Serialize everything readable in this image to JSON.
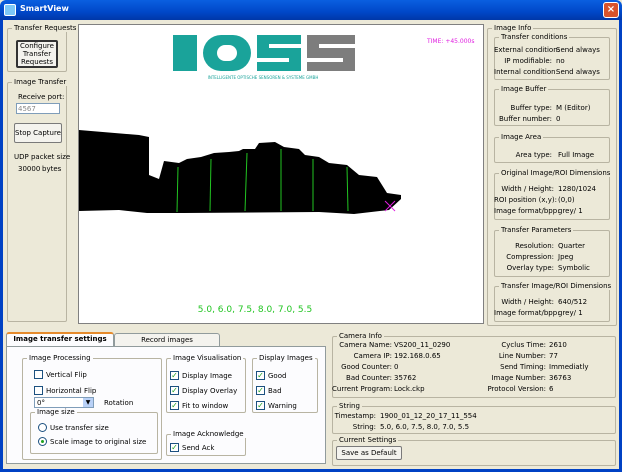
{
  "window": {
    "title": "SmartView",
    "close": "×"
  },
  "transfer_requests": {
    "label": "Transfer Requests",
    "button": "Configure Transfer Requests"
  },
  "image_transfer": {
    "label": "Image Transfer",
    "receive_port_label": "Receive port:",
    "receive_port_value": "4567",
    "stop_button": "Stop Capture",
    "udp_label": "UDP packet size",
    "udp_value": "30000",
    "udp_unit": "bytes"
  },
  "image": {
    "logo": "IOSS",
    "logo_sub": "INTELLIGENTE OPTISCHE SENSOREN & SYSTEME GMBH",
    "time": "TIME: +45.000s",
    "readings": "5.0,  6.0,  7.5,  8.0,  7.0,  5.5"
  },
  "image_info": {
    "label": "Image Info",
    "transfer_conditions": {
      "label": "Transfer conditions",
      "rows": [
        {
          "k": "External condition:",
          "v": "Send always"
        },
        {
          "k": "IP modifiable:",
          "v": "no"
        },
        {
          "k": "Internal condition:",
          "v": "Send always"
        }
      ]
    },
    "image_buffer": {
      "label": "Image Buffer",
      "rows": [
        {
          "k": "Buffer type:",
          "v": "M (Editor)"
        },
        {
          "k": "Buffer number:",
          "v": "0"
        }
      ]
    },
    "image_area": {
      "label": "Image Area",
      "rows": [
        {
          "k": "Area type:",
          "v": "Full Image"
        }
      ]
    },
    "original_dims": {
      "label": "Original Image/ROI Dimensions",
      "rows": [
        {
          "k": "Width / Height:",
          "v": "1280/1024"
        },
        {
          "k": "ROI position (x,y):",
          "v": "(0,0)"
        },
        {
          "k": "Image format/bpp:",
          "v": "grey/ 1"
        }
      ]
    },
    "transfer_params": {
      "label": "Transfer Parameters",
      "rows": [
        {
          "k": "Resolution:",
          "v": "Quarter"
        },
        {
          "k": "Compression:",
          "v": "Jpeg"
        },
        {
          "k": "Overlay type:",
          "v": "Symbolic"
        }
      ]
    },
    "transfer_dims": {
      "label": "Transfer Image/ROI Dimensions",
      "rows": [
        {
          "k": "Width / Height:",
          "v": "640/512"
        },
        {
          "k": "Image format/bpp:",
          "v": "grey/ 1"
        }
      ]
    }
  },
  "tabs": [
    {
      "label": "Image transfer settings"
    },
    {
      "label": "Record images"
    }
  ],
  "image_processing": {
    "label": "Image Processing",
    "vflip": "Vertical Flip",
    "hflip": "Horizontal Flip",
    "rotation_value": "0°",
    "rotation_label": "Rotation",
    "size_label": "Image size",
    "use_transfer": "Use transfer size",
    "scale_original": "Scale image to original size"
  },
  "visualisation": {
    "label": "Image Visualisation",
    "items": [
      "Display Image",
      "Display Overlay",
      "Fit to window"
    ]
  },
  "display_images": {
    "label": "Display Images",
    "items": [
      "Good",
      "Bad",
      "Warning"
    ]
  },
  "acknowledge": {
    "label": "Image Acknowledge",
    "send_ack": "Send Ack"
  },
  "camera_info": {
    "label": "Camera Info",
    "left": [
      {
        "k": "Camera Name:",
        "v": "VS200_11_0290"
      },
      {
        "k": "Camera IP:",
        "v": "192.168.0.65"
      },
      {
        "k": "Good Counter:",
        "v": "0"
      },
      {
        "k": "Bad Counter:",
        "v": "35762"
      },
      {
        "k": "Current Program:",
        "v": "Lock.ckp"
      }
    ],
    "right": [
      {
        "k": "Cyclus Time:",
        "v": "2610"
      },
      {
        "k": "Line Number:",
        "v": "77"
      },
      {
        "k": "Send Timing:",
        "v": "Immediatly"
      },
      {
        "k": "Image Number:",
        "v": "36763"
      },
      {
        "k": "Protocol Version:",
        "v": "6"
      }
    ]
  },
  "string_group": {
    "label": "String",
    "timestamp_label": "Timestamp:",
    "timestamp": "1900_01_12_20_17_11_554",
    "string_label": "String:",
    "string": "5.0,  6.0,  7.5,  8.0,  7.0,  5.5"
  },
  "current_settings": {
    "label": "Current Settings",
    "save": "Save as Default"
  },
  "colors": {
    "titlebar": "#0a5fe0",
    "logo": "#1aa39a",
    "measure": "#22c522",
    "overlay": "#e020e0"
  }
}
